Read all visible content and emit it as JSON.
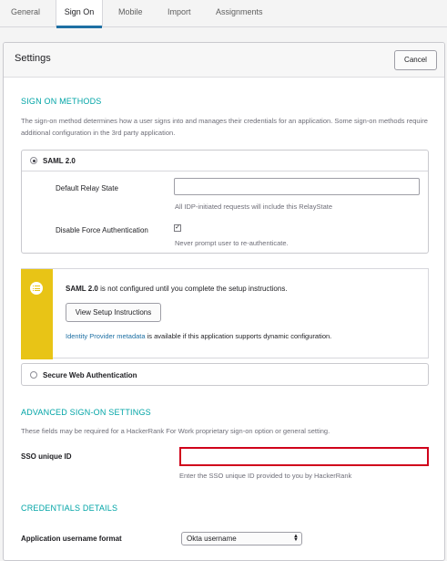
{
  "tabs": [
    {
      "label": "General"
    },
    {
      "label": "Sign On"
    },
    {
      "label": "Mobile"
    },
    {
      "label": "Import"
    },
    {
      "label": "Assignments"
    }
  ],
  "active_tab": "Sign On",
  "settings": {
    "title": "Settings",
    "cancel_label": "Cancel"
  },
  "sign_on_methods": {
    "heading": "SIGN ON METHODS",
    "description": "The sign-on method determines how a user signs into and manages their credentials for an application. Some sign-on methods require additional configuration in the 3rd party application.",
    "saml": {
      "label": "SAML 2.0",
      "selected": true,
      "relay_state_label": "Default Relay State",
      "relay_state_value": "",
      "relay_state_hint": "All IDP-initiated requests will include this RelayState",
      "force_auth_label": "Disable Force Authentication",
      "force_auth_checked": true,
      "force_auth_hint": "Never prompt user to re-authenticate."
    },
    "callout": {
      "strong": "SAML 2.0",
      "text": " is not configured until you complete the setup instructions.",
      "button_label": "View Setup Instructions",
      "link_text": "Identity Provider metadata",
      "link_suffix": " is available if this application supports dynamic configuration.",
      "icon": "list-icon",
      "accent_color": "#e8c416"
    },
    "swa": {
      "label": "Secure Web Authentication",
      "selected": false
    }
  },
  "advanced": {
    "heading": "ADVANCED SIGN-ON SETTINGS",
    "description": "These fields may be required for a HackerRank For Work proprietary sign-on option or general setting.",
    "sso_label": "SSO unique ID",
    "sso_value": "",
    "sso_hint": "Enter the SSO unique ID provided to you by HackerRank",
    "highlight_color": "#d0021b"
  },
  "credentials": {
    "heading": "CREDENTIALS DETAILS",
    "username_format_label": "Application username format",
    "username_format_value": "Okta username"
  }
}
